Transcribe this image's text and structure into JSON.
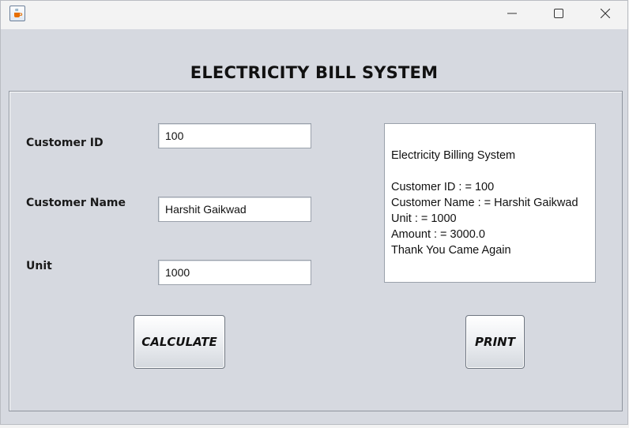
{
  "window": {
    "icon": "java-cup-icon",
    "controls": {
      "minimize_icon": "minimize-icon",
      "maximize_icon": "maximize-icon",
      "close_icon": "close-icon"
    }
  },
  "heading": "ELECTRICITY BILL SYSTEM",
  "form": {
    "customer_id": {
      "label": "Customer ID",
      "value": "100"
    },
    "customer_name": {
      "label": "Customer Name",
      "value": "Harshit Gaikwad"
    },
    "unit": {
      "label": "Unit",
      "value": "1000"
    }
  },
  "bill_output": {
    "lines": [
      "Electricity Billing System",
      "",
      "Customer ID : = 100",
      "Customer Name : = Harshit Gaikwad",
      "Unit : = 1000",
      "Amount : = 3000.0",
      "Thank You Came Again"
    ]
  },
  "buttons": {
    "calculate": "CALCULATE",
    "print": "PRINT"
  },
  "colors": {
    "window_bg": "#d6d9e0",
    "titlebar_bg": "#f3f3f3",
    "field_bg": "#ffffff"
  }
}
